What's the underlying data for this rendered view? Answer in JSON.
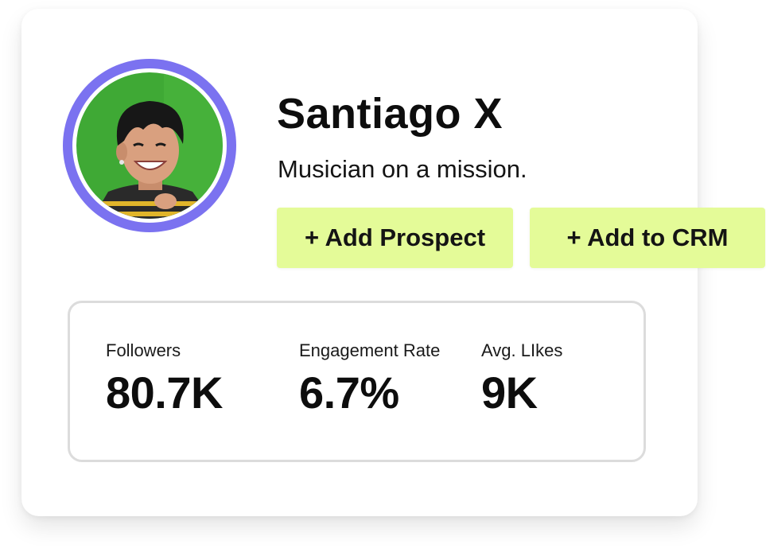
{
  "profile": {
    "name": "Santiago X",
    "bio": "Musician on a mission."
  },
  "actions": {
    "add_prospect_label": "+ Add Prospect",
    "add_to_crm_label": "+ Add to CRM"
  },
  "stats": [
    {
      "label": "Followers",
      "value": "80.7K"
    },
    {
      "label": "Engagement Rate",
      "value": "6.7%"
    },
    {
      "label": "Avg. LIkes",
      "value": "9K"
    }
  ],
  "colors": {
    "avatar_ring": "#7b72f0",
    "button_bg": "#e4fb98",
    "avatar_bg": "#3fa935"
  }
}
